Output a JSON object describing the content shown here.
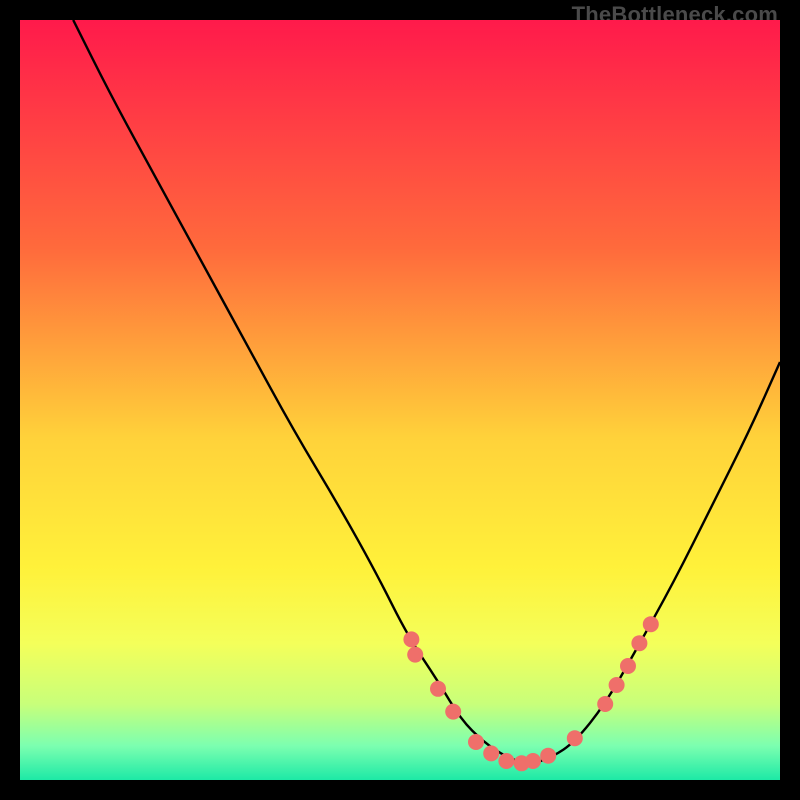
{
  "watermark": "TheBottleneck.com",
  "chart_data": {
    "type": "line",
    "title": "",
    "xlabel": "",
    "ylabel": "",
    "xlim": [
      0,
      100
    ],
    "ylim": [
      0,
      100
    ],
    "gradient_stops": [
      {
        "offset": 0,
        "color": "#ff1a4b"
      },
      {
        "offset": 0.3,
        "color": "#ff6a3c"
      },
      {
        "offset": 0.55,
        "color": "#ffd23a"
      },
      {
        "offset": 0.72,
        "color": "#fff13a"
      },
      {
        "offset": 0.82,
        "color": "#f4ff5a"
      },
      {
        "offset": 0.9,
        "color": "#c8ff7a"
      },
      {
        "offset": 0.955,
        "color": "#7cffb0"
      },
      {
        "offset": 1.0,
        "color": "#1de9a6"
      }
    ],
    "series": [
      {
        "name": "bottleneck-curve",
        "x": [
          7,
          12,
          18,
          24,
          30,
          36,
          42,
          47,
          51,
          55,
          58,
          61,
          64,
          67,
          70,
          73,
          77,
          81,
          86,
          91,
          96,
          100
        ],
        "y": [
          100,
          90,
          79,
          68,
          57,
          46,
          36,
          27,
          19,
          13,
          8,
          5,
          3,
          2,
          3,
          5,
          10,
          17,
          26,
          36,
          46,
          55
        ]
      }
    ],
    "markers": {
      "name": "highlight-dots",
      "color": "#ef6f6a",
      "radius": 8,
      "points": [
        {
          "x": 51.5,
          "y": 18.5
        },
        {
          "x": 52.0,
          "y": 16.5
        },
        {
          "x": 55.0,
          "y": 12.0
        },
        {
          "x": 57.0,
          "y": 9.0
        },
        {
          "x": 60.0,
          "y": 5.0
        },
        {
          "x": 62.0,
          "y": 3.5
        },
        {
          "x": 64.0,
          "y": 2.5
        },
        {
          "x": 66.0,
          "y": 2.2
        },
        {
          "x": 67.5,
          "y": 2.5
        },
        {
          "x": 69.5,
          "y": 3.2
        },
        {
          "x": 73.0,
          "y": 5.5
        },
        {
          "x": 77.0,
          "y": 10.0
        },
        {
          "x": 78.5,
          "y": 12.5
        },
        {
          "x": 80.0,
          "y": 15.0
        },
        {
          "x": 81.5,
          "y": 18.0
        },
        {
          "x": 83.0,
          "y": 20.5
        }
      ]
    }
  }
}
